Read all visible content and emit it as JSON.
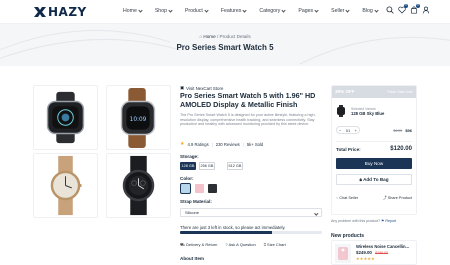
{
  "brand": {
    "name": "HAZY"
  },
  "nav": [
    {
      "label": "Home"
    },
    {
      "label": "Shop"
    },
    {
      "label": "Product"
    },
    {
      "label": "Features"
    },
    {
      "label": "Category"
    },
    {
      "label": "Pages"
    },
    {
      "label": "Seller"
    },
    {
      "label": "Blog"
    }
  ],
  "header_icons": {
    "wishlist_count": "0",
    "cart_count": "0"
  },
  "breadcrumb": {
    "home": "Home",
    "separator": "/",
    "current": "Product Details"
  },
  "page_title": "Pro Series Smart Watch 5",
  "product": {
    "store_link": "Visit NexCart Store",
    "title": "Pro Series Smart Watch 5 with 1.96\" HD AMOLED Display & Metallic Finish",
    "description": "The Pro Series Smart Watch 5 is designed for your active lifestyle, featuring a high-resolution display, comprehensive health tracking, and seamless connectivity. Stay productive and healthy with advanced monitoring provided by this sleek device.",
    "rating": "4.9 Ratings",
    "reviews": "230 Reviews",
    "sold": "5k+ Sold",
    "storage_label": "Storage:",
    "storage_options": [
      "128 GB",
      "256 GB",
      "512 GB"
    ],
    "color_label": "Color:",
    "colors": [
      "#b9d7ec",
      "#f3c2cb",
      "#2c2f34"
    ],
    "strap_label": "Strap Material:",
    "strap_value": "Silicone",
    "stock_text": "There are just 3 left in stock, so please act immediately.",
    "stock_level": 0.65,
    "links": [
      "Delivery & Return",
      "Ask A Question",
      "Size Chart"
    ],
    "about_title": "About Item"
  },
  "panel": {
    "discount": "39% OFF",
    "sale_label": "Flash Sale Live!",
    "selected_caption": "Selected Variant",
    "selected_variant": "128 GB Sky Blue",
    "qty": "01",
    "old_price": "$199",
    "price": "$96",
    "total_label": "Total Price:",
    "total_value": "$120.00",
    "buy_label": "Buy Now",
    "cart_label": "Add To Bag",
    "chat_label": "Chat Seller",
    "share_label": "Share Product",
    "problem_text": "Any problem with this product?",
    "report_label": "Report"
  },
  "new_products": {
    "title": "New products",
    "items": [
      {
        "name": "Wireless Noise Cancellin...",
        "price": "$249.00",
        "old_price": "$299.00",
        "stars": "★★★★★"
      }
    ]
  }
}
